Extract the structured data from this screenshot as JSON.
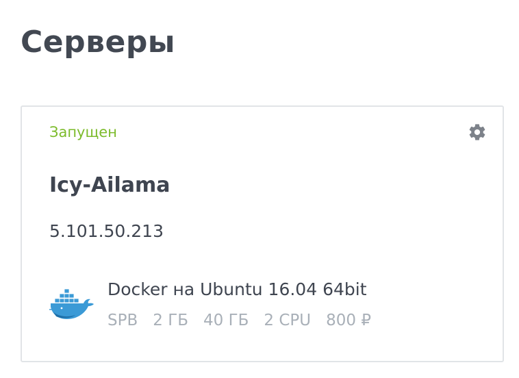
{
  "page": {
    "title": "Серверы"
  },
  "server": {
    "status": "Запущен",
    "status_color": "#7cbb2b",
    "name": "Icy-Ailama",
    "ip": "5.101.50.213",
    "os_icon": "docker-whale-icon",
    "os": "Docker на Ubuntu 16.04 64bit",
    "specs": {
      "region": "SPB",
      "ram": "2 ГБ",
      "disk": "40 ГБ",
      "cpu": "2 CPU",
      "price": "800 ₽"
    },
    "settings_icon": "gear-icon"
  }
}
